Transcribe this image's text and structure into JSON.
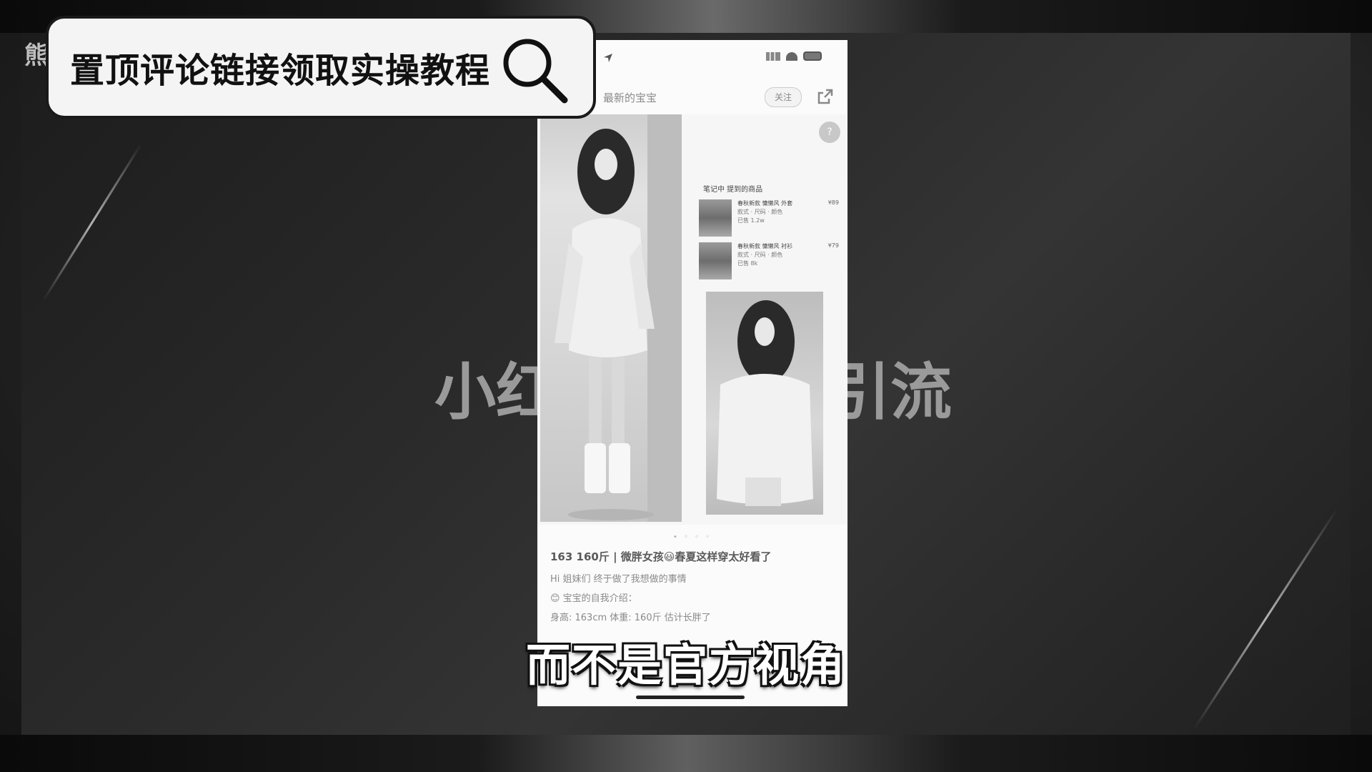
{
  "overlay": {
    "corner_mark": "熊",
    "search_text": "置顶评论链接领取实操教程",
    "bg_title_left": "小红",
    "bg_title_right": "引流",
    "subtitle": "而不是官方视角"
  },
  "phone": {
    "status_time": "",
    "author": "最新的宝宝",
    "follow_label": "关注",
    "avatar_badge": "?",
    "shop": {
      "heading": "笔记中 提到的商品",
      "items": [
        {
          "name": "春秋新款 慵懒风 外套",
          "meta": "款式 · 尺码 · 颜色",
          "sub": "已售 1.2w",
          "price": "¥89"
        },
        {
          "name": "春秋新款 慵懒风 衬衫",
          "meta": "款式 · 尺码 · 颜色",
          "sub": "已售 8k",
          "price": "¥79"
        }
      ]
    },
    "pager": "• ◦ ◦ ◦",
    "post": {
      "title": "163 160斤 | 微胖女孩😃春夏这样穿太好看了",
      "lines": [
        "Hi 姐妹们 终于做了我想做的事情",
        "😊 宝宝的自我介绍：",
        "身高: 163cm 体重: 160斤 估计长胖了"
      ]
    }
  },
  "colors": {
    "search_bg": "#f4f4f4",
    "subtitle_fill": "#ffffff",
    "subtitle_stroke": "#111111"
  }
}
